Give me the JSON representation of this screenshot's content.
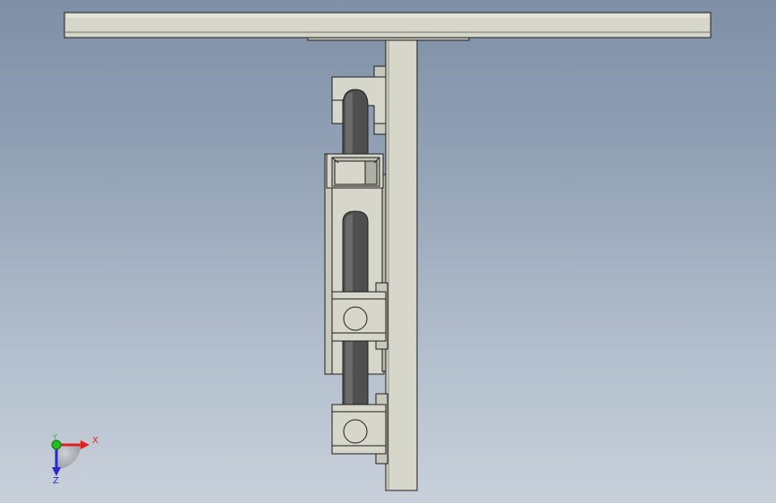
{
  "viewport": {
    "background_top": "#7e8fa6",
    "background_bottom": "#c8d0da",
    "part_fill": "#d6d6cb",
    "part_shade": "#b8b8ad",
    "rod_fill": "#4f4f4f",
    "edge_color": "#1e1e1e"
  },
  "triad": {
    "x_label": "X",
    "y_label": "Y",
    "z_label": "Z",
    "x_color": "#e02020",
    "y_color": "#20c020",
    "z_color": "#2a2ad0"
  }
}
